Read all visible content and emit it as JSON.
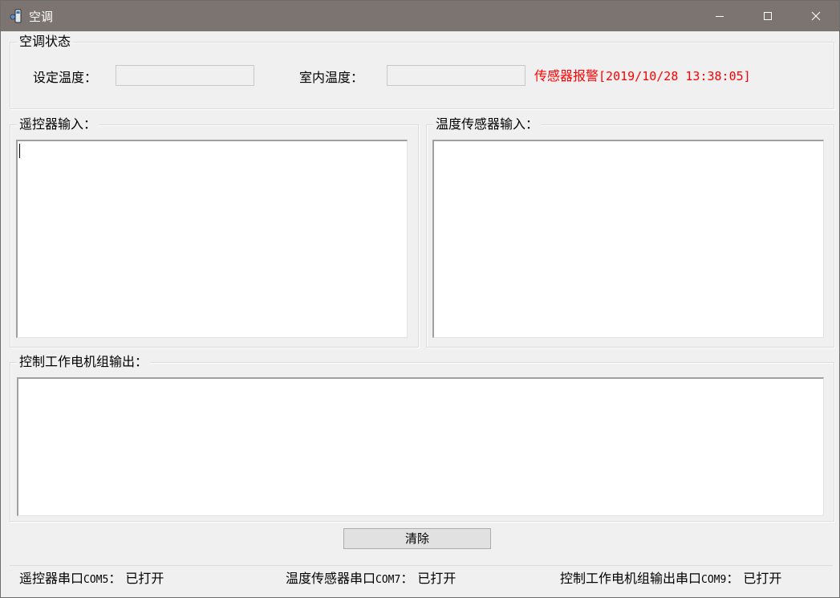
{
  "window": {
    "title": "空调",
    "icon": "air-conditioner-app-icon",
    "colors": {
      "titlebar": "#7c7471",
      "alarm": "#ff0000"
    }
  },
  "status_group": {
    "label": "空调状态",
    "set_temp_label": "设定温度：",
    "set_temp_value": "",
    "room_temp_label": "室内温度：",
    "room_temp_value": "",
    "alarm_text": "传感器报警",
    "alarm_timestamp": "[2019/10/28 13:38:05]"
  },
  "remote_group": {
    "label": "遥控器输入：",
    "content": ""
  },
  "sensor_group": {
    "label": "温度传感器输入：",
    "content": ""
  },
  "output_group": {
    "label": "控制工作电机组输出：",
    "content": ""
  },
  "clear_button": {
    "label": "清除"
  },
  "statusbar": {
    "items": [
      {
        "prefix": "遥控器串口",
        "port": "COM5",
        "suffix": "： 已打开"
      },
      {
        "prefix": "温度传感器串口",
        "port": "COM7",
        "suffix": "： 已打开"
      },
      {
        "prefix": "控制工作电机组输出串口",
        "port": "COM9",
        "suffix": "： 已打开"
      }
    ]
  }
}
